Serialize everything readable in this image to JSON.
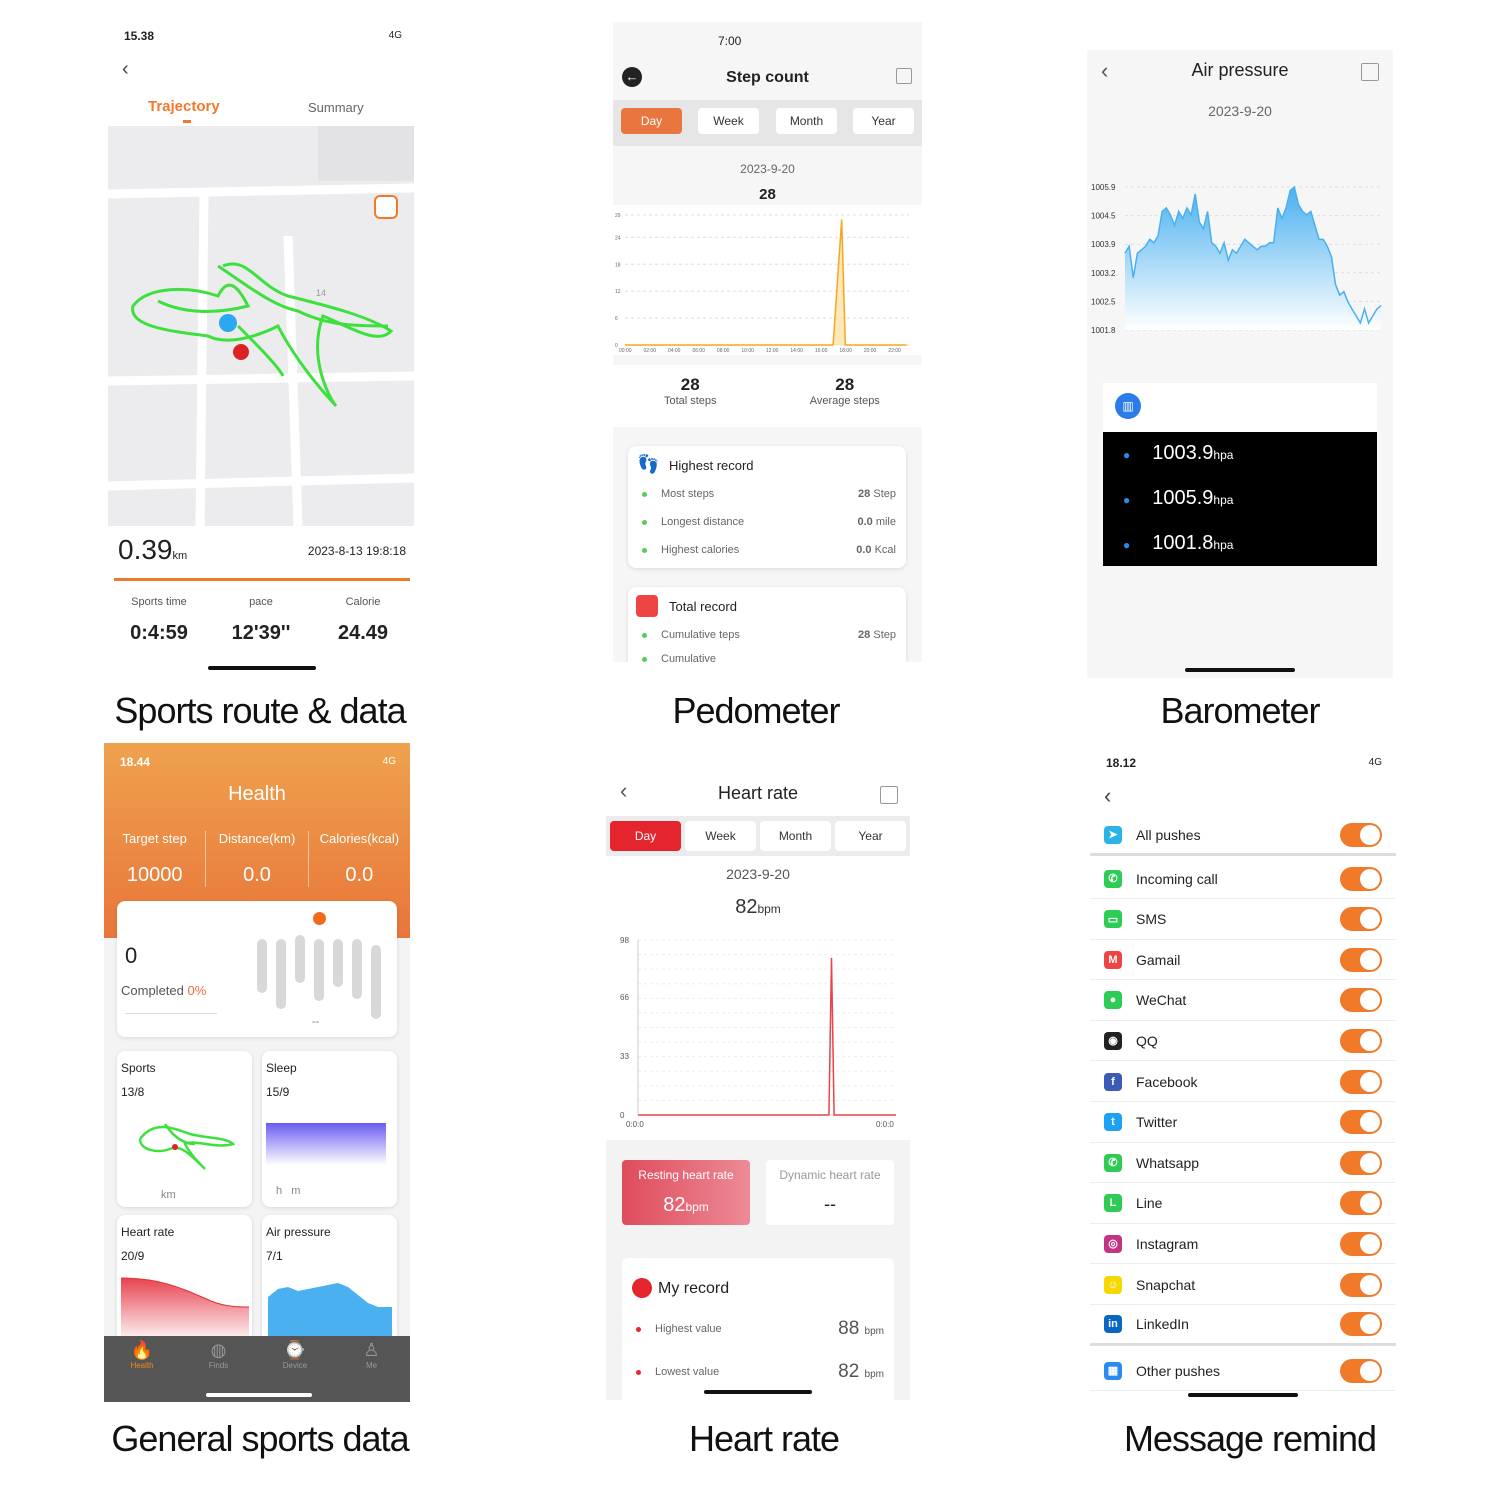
{
  "captions": [
    "Sports route & data",
    "Pedometer",
    "Barometer",
    "General sports  data",
    "Heart rate",
    "Message remind"
  ],
  "sports_route": {
    "status_time": "15.38",
    "status_net": "4G",
    "tabs": [
      "Trajectory",
      "Summary"
    ],
    "active_tab": "Trajectory",
    "map_label": "14",
    "distance": "0.39",
    "distance_unit": "km",
    "datetime": "2023-8-13 19:8:18",
    "stats": [
      {
        "label": "Sports time",
        "value": "0:4:59"
      },
      {
        "label": "pace",
        "value": "12'39''"
      },
      {
        "label": "Calorie",
        "value": "24.49"
      }
    ],
    "route_color": "#3ee03e",
    "accent": "#f07a2a"
  },
  "pedometer": {
    "status_time": "7:00",
    "title": "Step count",
    "tabs": [
      "Day",
      "Week",
      "Month",
      "Year"
    ],
    "active_tab": "Day",
    "date": "2023-9-20",
    "value": "28",
    "chart_data": {
      "type": "area",
      "y_ticks": [
        0,
        6,
        12,
        18,
        24,
        29
      ],
      "x_ticks": [
        "00:00",
        "02:00",
        "04:00",
        "06:00",
        "08:00",
        "10:00",
        "12:00",
        "14:00",
        "16:00",
        "18:00",
        "20:00",
        "22:00"
      ],
      "points": [
        [
          0,
          0
        ],
        [
          16,
          0
        ],
        [
          17,
          0
        ],
        [
          17.7,
          28
        ],
        [
          18,
          0
        ],
        [
          19,
          0
        ],
        [
          23,
          0
        ]
      ],
      "color": "#f5a623"
    },
    "summary": [
      {
        "value": "28",
        "label": "Total steps"
      },
      {
        "value": "28",
        "label": "Average steps"
      }
    ],
    "highest": {
      "title": "Highest record",
      "items": [
        {
          "label": "Most steps",
          "value": "28",
          "unit": "Step"
        },
        {
          "label": "Longest distance",
          "value": "0.0",
          "unit": "mile"
        },
        {
          "label": "Highest calories",
          "value": "0.0",
          "unit": "Kcal"
        }
      ]
    },
    "total": {
      "title": "Total record",
      "items": [
        {
          "label": "Cumulative teps",
          "value": "28",
          "unit": "Step"
        },
        {
          "label": "Cumulative",
          "value": "",
          "unit": ""
        }
      ]
    }
  },
  "barometer": {
    "title": "Air pressure",
    "date": "2023-9-20",
    "chart_data": {
      "type": "area",
      "y_ticks": [
        "1005.9",
        "1004.5",
        "1003.9",
        "1003.2",
        "1002.5",
        "1001.8"
      ],
      "ylim": [
        1001.8,
        1005.9
      ],
      "color": "#4ab0ef",
      "values": [
        1004.0,
        1004.2,
        1003.3,
        1004.0,
        1004.1,
        1004.2,
        1004.4,
        1004.3,
        1004.5,
        1005.2,
        1005.3,
        1005.1,
        1004.8,
        1005.2,
        1005.0,
        1005.3,
        1005.1,
        1005.7,
        1004.9,
        1004.7,
        1005.2,
        1004.3,
        1004.2,
        1004.0,
        1004.3,
        1003.8,
        1004.1,
        1004.0,
        1004.2,
        1004.4,
        1004.3,
        1004.2,
        1004.1,
        1004.2,
        1004.2,
        1004.3,
        1004.3,
        1005.3,
        1005.0,
        1005.3,
        1005.8,
        1005.9,
        1005.4,
        1005.2,
        1005.1,
        1005.2,
        1004.8,
        1004.4,
        1004.4,
        1004.2,
        1003.9,
        1003.1,
        1002.8,
        1002.9,
        1002.6,
        1002.4,
        1002.2,
        1002.0,
        1002.4,
        1002.0,
        1002.2,
        1002.4,
        1002.5
      ]
    },
    "readings": [
      {
        "value": "1003.9",
        "unit": "hpa"
      },
      {
        "value": "1005.9",
        "unit": "hpa"
      },
      {
        "value": "1001.8",
        "unit": "hpa"
      }
    ]
  },
  "general": {
    "status_time": "18.44",
    "status_net": "4G",
    "title": "Health",
    "stats": [
      {
        "label": "Target step",
        "value": "10000"
      },
      {
        "label": "Distance(km)",
        "value": "0.0"
      },
      {
        "label": "Calories(kcal)",
        "value": "0.0"
      }
    ],
    "steps": "0",
    "completed_label": "Completed",
    "completed_value": "0%",
    "bars_caption": "--",
    "tiles": [
      {
        "title": "Sports",
        "date": "13/8",
        "foot": "km"
      },
      {
        "title": "Sleep",
        "date": "15/9",
        "foot": "h   m"
      },
      {
        "title": "Heart rate",
        "date": "20/9"
      },
      {
        "title": "Air pressure",
        "date": "7/1"
      }
    ],
    "nav": [
      {
        "label": "Health",
        "icon": "flame-icon",
        "active": true
      },
      {
        "label": "Finds",
        "icon": "planet-icon"
      },
      {
        "label": "Device",
        "icon": "watch-icon"
      },
      {
        "label": "Me",
        "icon": "person-icon"
      }
    ]
  },
  "heart_rate": {
    "title": "Heart rate",
    "tabs": [
      "Day",
      "Week",
      "Month",
      "Year"
    ],
    "active_tab": "Day",
    "date": "2023-9-20",
    "value": "82",
    "unit": "bpm",
    "chart_data": {
      "type": "line",
      "y_ticks": [
        0,
        33,
        66,
        98
      ],
      "x_labels": [
        "0:0:0",
        "0:0:0"
      ],
      "color": "#e8434f",
      "points": [
        [
          0,
          0
        ],
        [
          0.74,
          0
        ],
        [
          0.75,
          88
        ],
        [
          0.76,
          0
        ],
        [
          1,
          0
        ]
      ]
    },
    "resting": {
      "label": "Resting heart rate",
      "value": "82",
      "unit": "bpm"
    },
    "dynamic": {
      "label": "Dynamic heart rate",
      "value": "--"
    },
    "record": {
      "title": "My record",
      "items": [
        {
          "label": "Highest value",
          "value": "88",
          "unit": "bpm"
        },
        {
          "label": "Lowest value",
          "value": "82",
          "unit": "bpm"
        }
      ]
    }
  },
  "message": {
    "status_time": "18.12",
    "status_net": "4G",
    "items": [
      {
        "label": "All pushes",
        "color": "#2bb3e8",
        "glyph": "➤",
        "on": true
      },
      {
        "label": "Incoming call",
        "color": "#2ecc55",
        "glyph": "✆",
        "on": true
      },
      {
        "label": "SMS",
        "color": "#2ecc55",
        "glyph": "▭",
        "on": true
      },
      {
        "label": "Gamail",
        "color": "#e44",
        "glyph": "M",
        "on": true
      },
      {
        "label": "WeChat",
        "color": "#2ecc55",
        "glyph": "●",
        "on": true
      },
      {
        "label": "QQ",
        "color": "#222",
        "glyph": "◉",
        "on": true
      },
      {
        "label": "Facebook",
        "color": "#3b5bb5",
        "glyph": "f",
        "on": true
      },
      {
        "label": "Twitter",
        "color": "#1da1f2",
        "glyph": "t",
        "on": true
      },
      {
        "label": "Whatsapp",
        "color": "#2ecc55",
        "glyph": "✆",
        "on": true
      },
      {
        "label": "Line",
        "color": "#2ecc55",
        "glyph": "L",
        "on": true
      },
      {
        "label": "Instagram",
        "color": "#c13584",
        "glyph": "◎",
        "on": true
      },
      {
        "label": "Snapchat",
        "color": "#f5d800",
        "glyph": "☺",
        "on": true
      },
      {
        "label": "LinkedIn",
        "color": "#0a66c2",
        "glyph": "in",
        "on": true
      },
      {
        "label": "Other pushes",
        "color": "#2b8af0",
        "glyph": "▦",
        "on": true
      }
    ]
  }
}
